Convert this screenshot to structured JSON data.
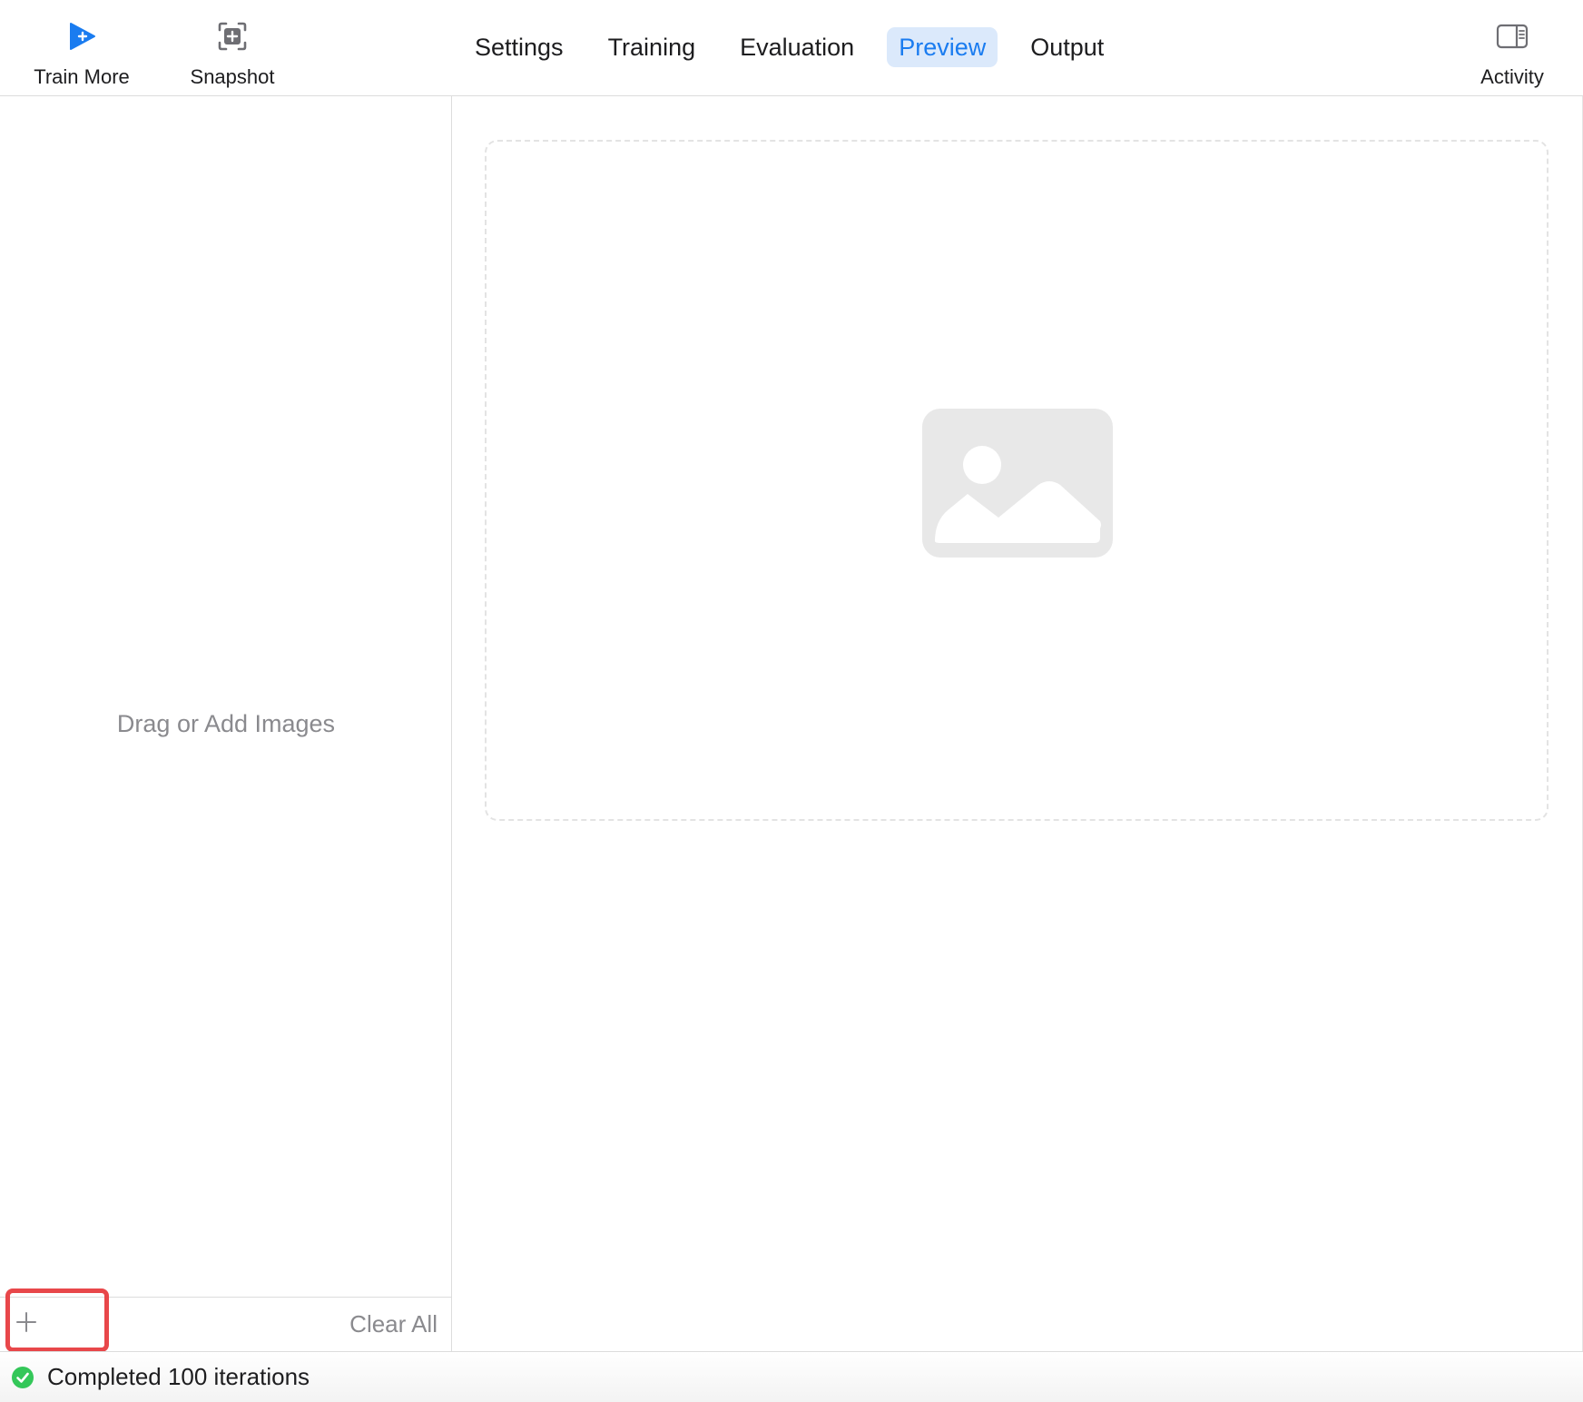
{
  "toolbar": {
    "train_more": {
      "label": "Train More",
      "icon": "play-plus-icon",
      "color": "#1a7cf0"
    },
    "snapshot": {
      "label": "Snapshot",
      "icon": "snapshot-icon"
    },
    "activity": {
      "label": "Activity",
      "icon": "sidebar-right-icon"
    }
  },
  "tabs": [
    {
      "label": "Settings",
      "active": false
    },
    {
      "label": "Training",
      "active": false
    },
    {
      "label": "Evaluation",
      "active": false
    },
    {
      "label": "Preview",
      "active": true
    },
    {
      "label": "Output",
      "active": false
    }
  ],
  "left_pane": {
    "drop_hint": "Drag or Add Images",
    "add_icon": "plus-icon",
    "clear_all": "Clear All"
  },
  "preview": {
    "placeholder_icon": "image-placeholder-icon"
  },
  "status": {
    "text": "Completed 100 iterations",
    "icon": "checkmark-circle-icon",
    "color": "#34c759"
  },
  "colors": {
    "accent": "#1a7cf0",
    "active_tab_bg": "#dbe9fb",
    "highlight_box": "#e8474a",
    "success": "#34c759"
  }
}
